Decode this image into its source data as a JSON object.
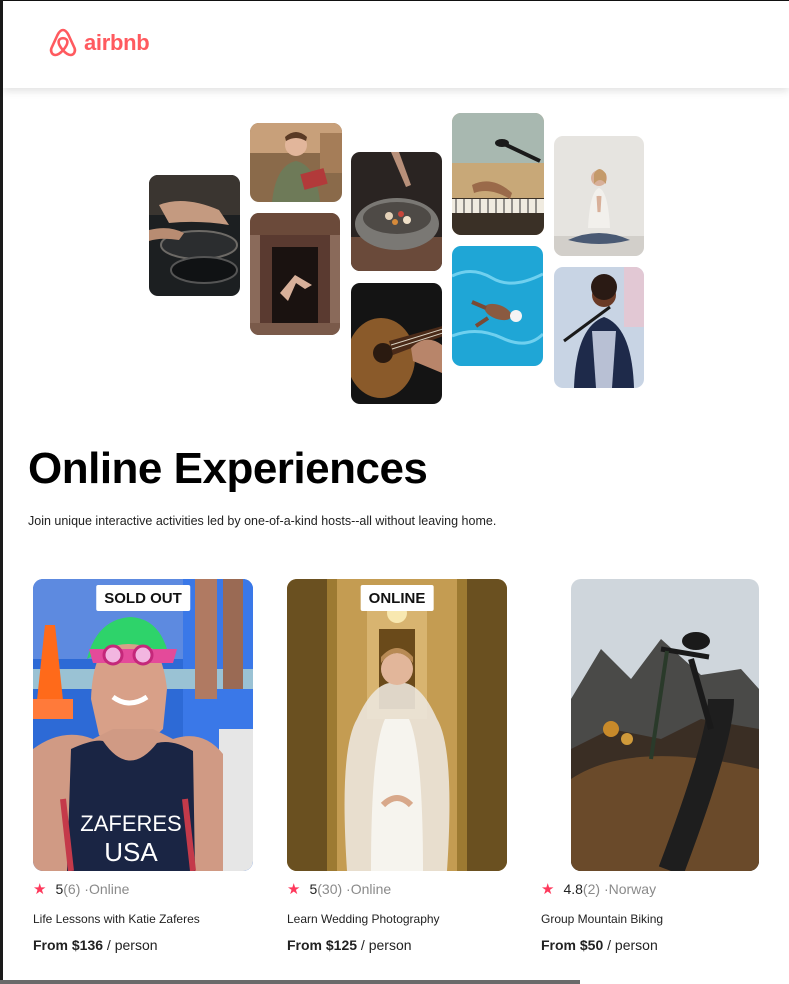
{
  "brand": {
    "name": "airbnb",
    "color": "#ff5a5f",
    "icon": "airbnb-logo-icon"
  },
  "hero": {
    "title": "Online Experiences",
    "subtitle": "Join unique interactive activities led by one-of-a-kind hosts--all without leaving home."
  },
  "gallery": [
    {
      "subject": "cooking-pans"
    },
    {
      "subject": "woman-holding-book"
    },
    {
      "subject": "dancer-in-doorway"
    },
    {
      "subject": "food-bowl"
    },
    {
      "subject": "acoustic-guitar"
    },
    {
      "subject": "piano-microphone"
    },
    {
      "subject": "swimmer-pool"
    },
    {
      "subject": "yoga-meditation"
    },
    {
      "subject": "singer-microphone"
    }
  ],
  "accent_star_color": "#fe395c",
  "cards": [
    {
      "badge": "SOLD OUT",
      "rating": "5",
      "reviews": "(6)",
      "location": "Online",
      "title": "Life Lessons with Katie Zaferes",
      "price": "From $136",
      "unit": "person",
      "photo": "swimmer-katie-zaferes",
      "shirt_text_1": "ZAFERES",
      "shirt_text_2": "USA"
    },
    {
      "badge": "ONLINE",
      "rating": "5",
      "reviews": "(30)",
      "location": "Online",
      "title": "Learn Wedding Photography",
      "price": "From $125",
      "unit": "person",
      "photo": "bride-in-hallway"
    },
    {
      "badge": "",
      "rating": "4.8",
      "reviews": "(2)",
      "location": "Norway",
      "title": "Group Mountain Biking",
      "price": "From $50",
      "unit": "person",
      "photo": "mountain-bike"
    }
  ],
  "separators": {
    "dot": "·",
    "per": " / "
  }
}
